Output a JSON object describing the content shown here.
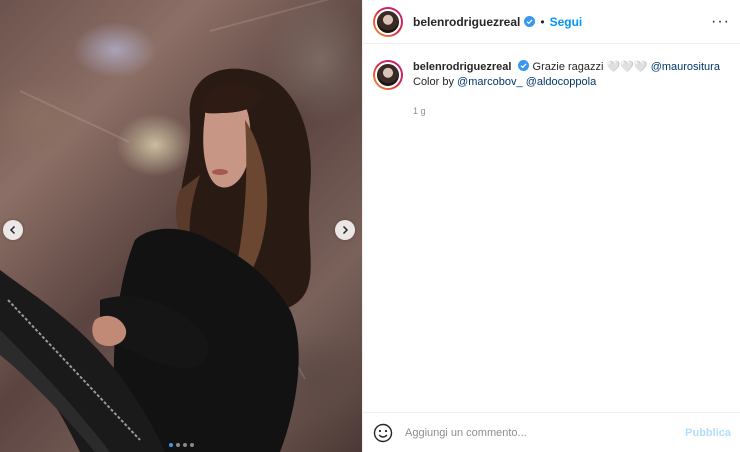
{
  "post": {
    "author": {
      "username": "belenrodriguezreal",
      "verified": true
    },
    "header": {
      "separator": "•",
      "follow_label": "Segui",
      "more_icon": "more-horizontal-icon",
      "more_glyph": "···"
    },
    "caption": {
      "username": "belenrodriguezreal",
      "text_prefix": "Grazie ragazzi",
      "hearts": "🤍🤍🤍",
      "mention_1": "@maurositura",
      "text_middle": "Color by",
      "mention_2": "@marcobov_",
      "mention_3": "@aldocoppola",
      "time": "1 g"
    },
    "carousel": {
      "slide_count": 4,
      "active_index": 0
    },
    "comment": {
      "placeholder": "Aggiungi un commento...",
      "publish_label": "Pubblica"
    },
    "colors": {
      "accent": "#0095f6",
      "publish_disabled": "#b2dffc",
      "active_dot": "#3897f0"
    }
  }
}
